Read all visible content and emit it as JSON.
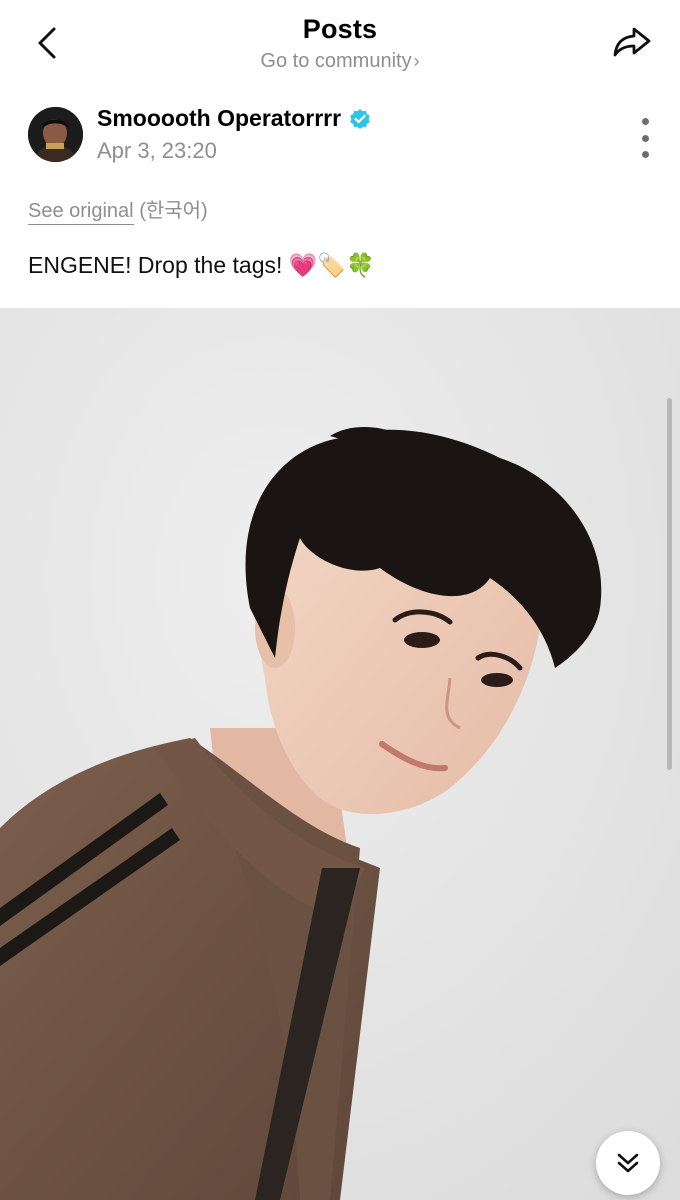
{
  "header": {
    "title": "Posts",
    "community_link": "Go to community",
    "back_icon": "chevron-left-icon",
    "share_icon": "share-arrow-icon"
  },
  "post": {
    "author": "Smooooth Operatorrrr",
    "verified": true,
    "verified_color": "#2ec4e6",
    "date": "Apr 3, 23:20",
    "see_original": "See original",
    "language": "(한국어)",
    "text": "ENGENE! Drop the tags! 💗🏷️🍀",
    "more_icon": "vertical-dots-icon"
  },
  "media": {
    "description_icon": "photo",
    "scroll_button_icon": "double-chevron-down-icon"
  }
}
